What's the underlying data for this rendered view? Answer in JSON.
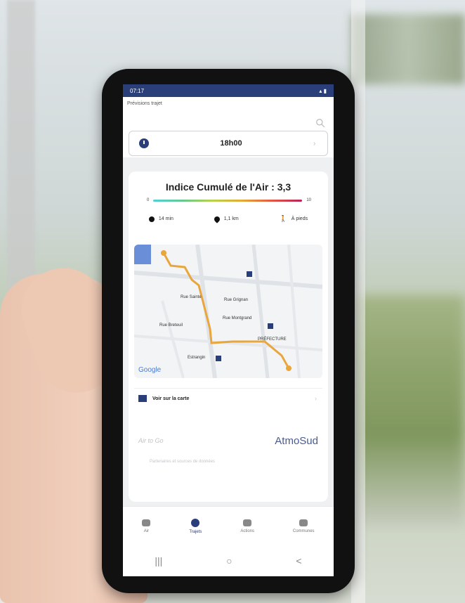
{
  "status_bar": {
    "time": "07:17",
    "icons_left": "notification-icons",
    "icons_right": "signal-battery-icons"
  },
  "header": {
    "title": "Prévisions trajet",
    "search_icon": "search-icon"
  },
  "time_field": {
    "value": "18h00",
    "icon": "clock-icon"
  },
  "air_index": {
    "title": "Indice Cumulé de l'Air : 3,3",
    "scale_min": "0",
    "scale_max": "10",
    "duration": "14 min",
    "distance": "1,1 km",
    "mode": "À pieds"
  },
  "map": {
    "provider": "Google",
    "labels": {
      "prefecture": "PRÉFECTURE",
      "estrangin": "Estrangin",
      "rue_sainte": "Rue Sainte",
      "rue_breteuil": "Rue Breteuil",
      "rue_grignan": "Rue Grignan",
      "rue_montgrand": "Rue Montgrand"
    }
  },
  "see_map": {
    "label": "Voir sur la carte"
  },
  "partners": {
    "airtogo": "Air to Go",
    "atmosud": "AtmoSud",
    "caption": "Partenaires et sources de données"
  },
  "bottom_nav": [
    {
      "label": "Air",
      "icon": "cloud-icon"
    },
    {
      "label": "Trajets",
      "icon": "route-icon",
      "active": true
    },
    {
      "label": "Actions",
      "icon": "bell-icon"
    },
    {
      "label": "Communes",
      "icon": "city-icon"
    }
  ],
  "system_nav": {
    "recent": "|||",
    "home": "○",
    "back": "<"
  },
  "colors": {
    "primary": "#2a3e79",
    "route": "#e8a63c"
  }
}
